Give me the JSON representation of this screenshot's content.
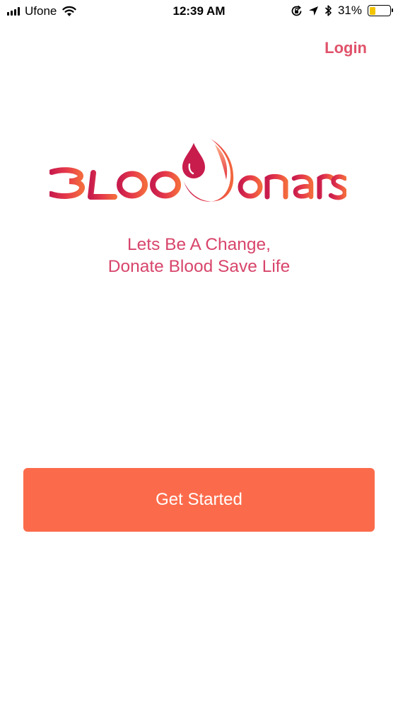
{
  "status_bar": {
    "carrier": "Ufone",
    "time": "12:39 AM",
    "battery_percent": "31%",
    "battery_level": 0.31,
    "battery_color": "#f3c400"
  },
  "header": {
    "login_label": "Login",
    "login_color": "#e0526a"
  },
  "logo": {
    "wordmark": "BLOODonars"
  },
  "tagline": {
    "line1": "Lets Be A Change,",
    "line2": "Donate Blood Save Life",
    "color": "#d8456b"
  },
  "actions": {
    "get_started_label": "Get Started",
    "get_started_color": "#fb6b4b"
  }
}
